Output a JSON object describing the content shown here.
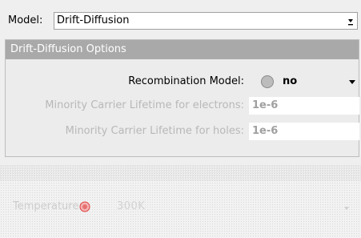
{
  "model": {
    "label": "Model:",
    "selected": "Drift-Diffusion"
  },
  "drift_diffusion_options": {
    "title": "Drift-Diffusion Options",
    "recombination": {
      "label": "Recombination Model:",
      "selected": "no",
      "radio_color": "#bcbcbc"
    },
    "lifetime_electrons": {
      "label": "Minority Carrier Lifetime for electrons:",
      "value": "1e-6"
    },
    "lifetime_holes": {
      "label": "Minority Carrier Lifetime for holes:",
      "value": "1e-6"
    }
  },
  "temperature": {
    "label": "Temperature:",
    "value": "300K",
    "icon": "temperature-icon",
    "icon_color": "#e04040"
  },
  "colors": {
    "header_bg": "#a9a9a9",
    "disabled_text": "#b8b8b8"
  }
}
